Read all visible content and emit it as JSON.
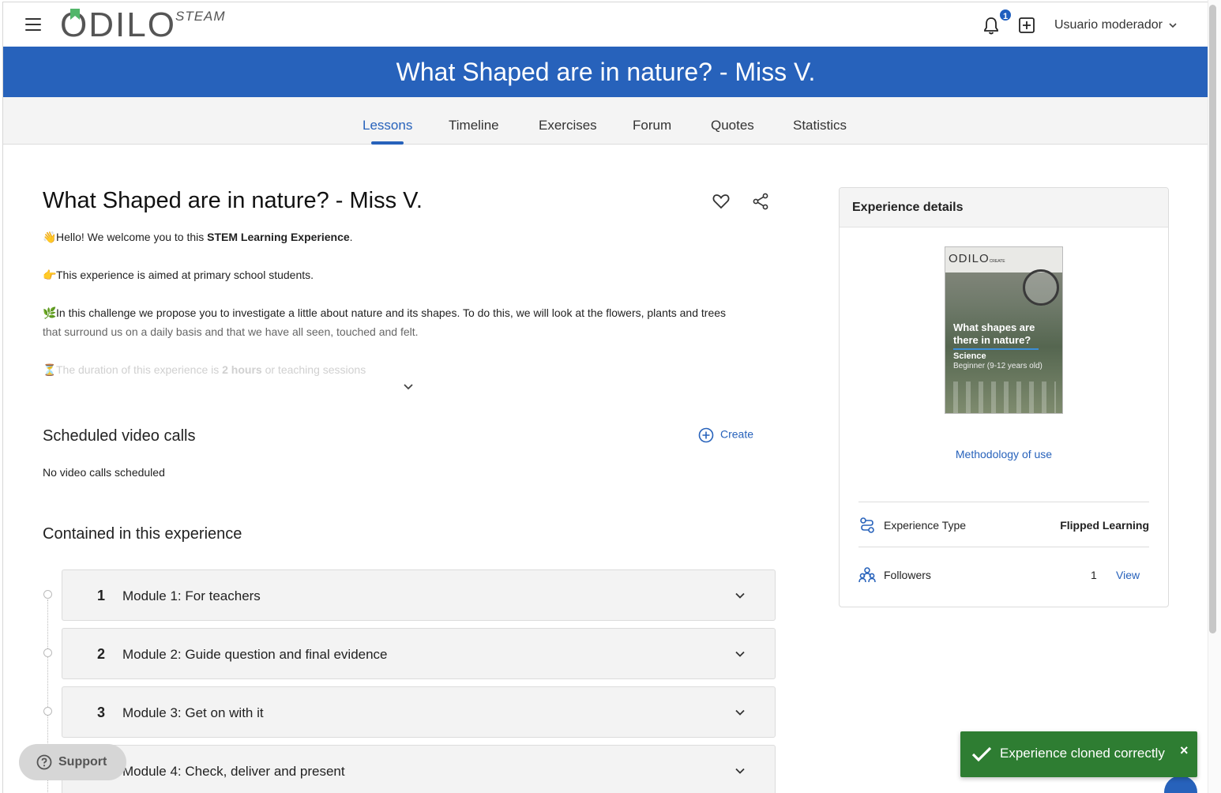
{
  "app": {
    "logo": "ODILO",
    "product": "STEAM"
  },
  "header": {
    "notification_count": "1",
    "user_name": "Usuario moderador"
  },
  "banner": {
    "title": "What Shaped are in nature? - Miss V."
  },
  "tabs": [
    {
      "label": "Lessons",
      "active": true
    },
    {
      "label": "Timeline"
    },
    {
      "label": "Exercises"
    },
    {
      "label": "Forum"
    },
    {
      "label": "Quotes"
    },
    {
      "label": "Statistics"
    }
  ],
  "main": {
    "title": "What Shaped are in nature? - Miss V.",
    "description": {
      "p1_emoji": "👋",
      "p1_pre": "Hello! We welcome you to this ",
      "p1_bold": "STEM Learning Experience",
      "p1_post": ".",
      "p2_emoji": "👉",
      "p2": "This experience is aimed at primary school students.",
      "p3_emoji": "🌿",
      "p3_line1": "In this challenge we propose you to investigate a little about nature and its shapes. To do this, we will look at the flowers, plants and trees",
      "p3_line2": "that surround us on a daily basis and that we have all seen, touched and felt.",
      "p4_emoji": "⏳",
      "p4_pre": "The duration of this experience is ",
      "p4_bold": "2 hours",
      "p4_post": " or teaching sessions"
    },
    "video_calls": {
      "heading": "Scheduled video calls",
      "create_label": "Create",
      "empty": "No video calls scheduled"
    },
    "contained": {
      "heading": "Contained in this experience",
      "modules": [
        {
          "num": "1",
          "title": "Module 1: For teachers"
        },
        {
          "num": "2",
          "title": "Module 2: Guide question and final evidence"
        },
        {
          "num": "3",
          "title": "Module 3: Get on with it"
        },
        {
          "num": "4",
          "title": "Module 4: Check, deliver and present"
        }
      ]
    }
  },
  "sidebar": {
    "heading": "Experience details",
    "cover": {
      "logo": "ODILO",
      "logo_suffix": "CREATE",
      "title": "What shapes are there in nature?",
      "subject": "Science",
      "level": "Beginner (9-12 years old)"
    },
    "methodology_link": "Methodology of use",
    "experience_type": {
      "label": "Experience Type",
      "value": "Flipped Learning"
    },
    "followers": {
      "label": "Followers",
      "count": "1",
      "action": "View"
    }
  },
  "support": {
    "label": "Support"
  },
  "toast": {
    "message": "Experience cloned correctly",
    "close": "×"
  },
  "colors": {
    "brand_blue": "#2762bb",
    "success_green": "#2e7d32"
  }
}
